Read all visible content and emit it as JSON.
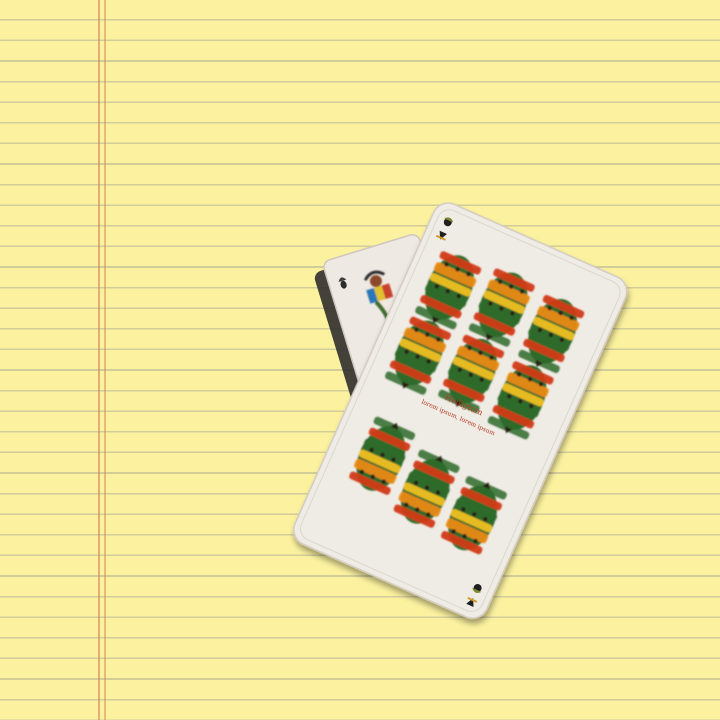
{
  "scene": {
    "background": "yellow legal pad",
    "paper_color": "#fbf19f",
    "margin_line_color": "#d27850"
  },
  "cards": [
    {
      "position": "back",
      "partially_hidden": true,
      "suit": "acorns",
      "rank_name": "Under",
      "colors": {
        "face": "#efe9e3",
        "shadow": "#3a3a3a"
      }
    },
    {
      "position": "front",
      "suit": "bells",
      "rank": 9,
      "pip_count": 9,
      "corner_suit_icon": "acorn-icon",
      "printed_text": [
        "Heiligtum",
        "lorem ipsum, lorem ipsum"
      ],
      "colors": {
        "face": "#efebe5",
        "bell_red": "#d23a18",
        "bell_orange": "#e98a12",
        "bell_yellow": "#f0c020",
        "bell_green": "#2f6a2a",
        "pip_black": "#2a1d12",
        "text_red": "#b83a22"
      }
    }
  ]
}
